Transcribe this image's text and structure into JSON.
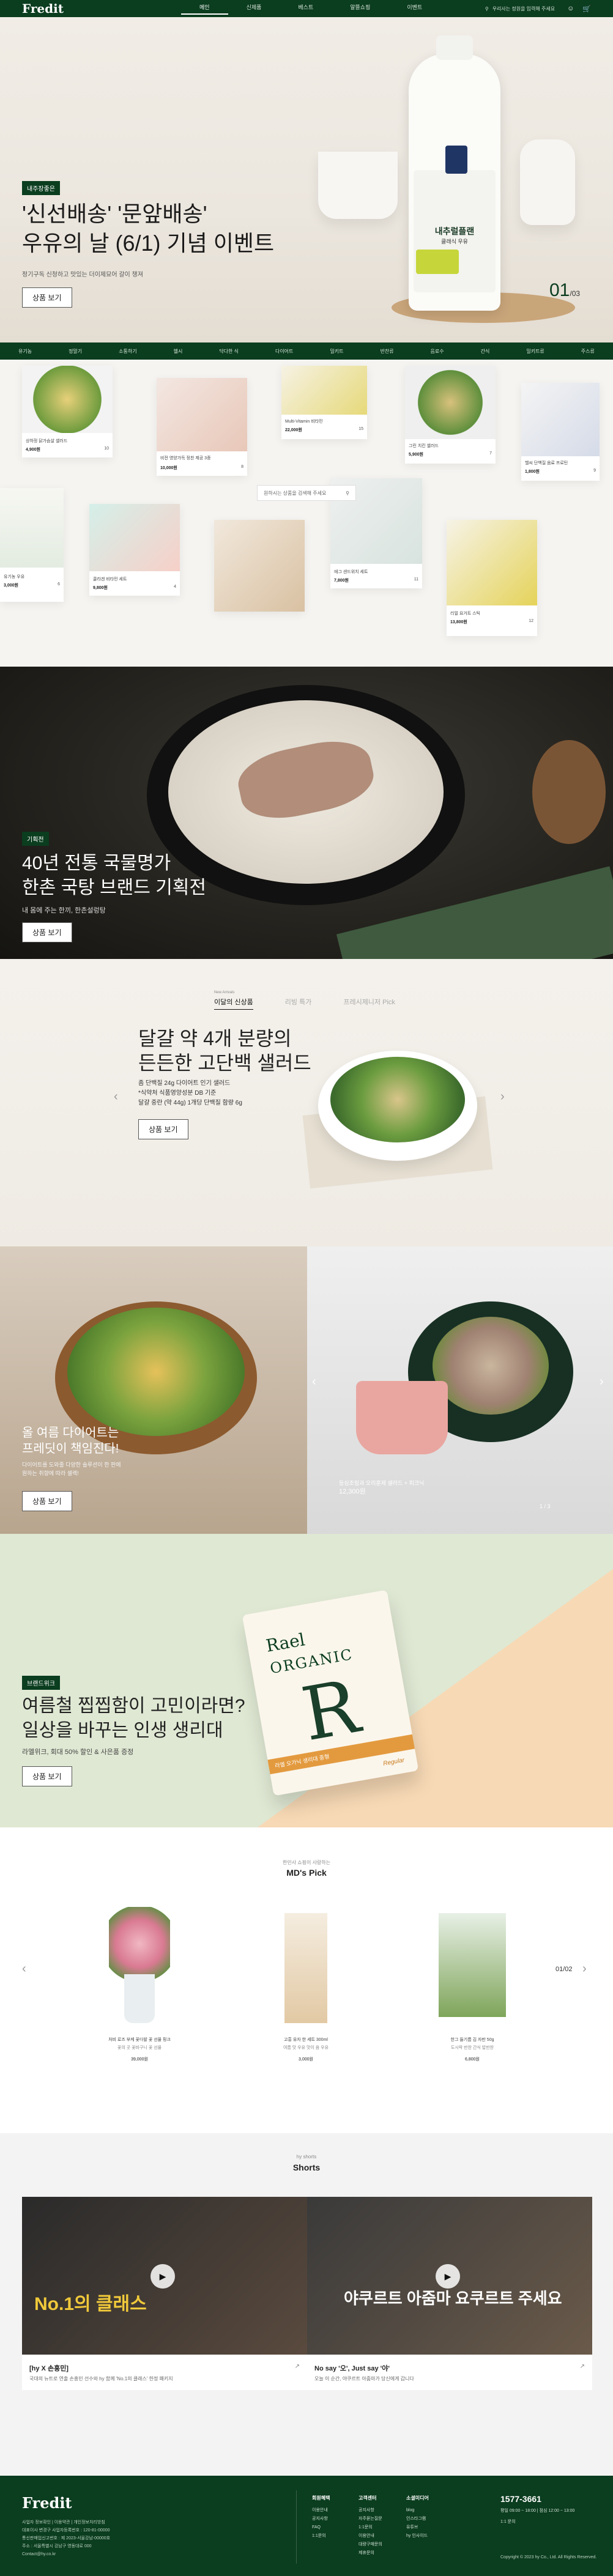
{
  "header": {
    "logo": "Fredit",
    "nav": [
      "메인",
      "신제품",
      "베스트",
      "알뜰쇼핑",
      "이벤트"
    ],
    "search_placeholder": "우리사는 정원을 입력해 주세요"
  },
  "hero": {
    "tag": "내주장좋은",
    "title_line1": "'신선배송' '문앞배송'",
    "title_line2": "우유의 날 (6/1) 기념 이벤트",
    "desc": "정기구독 신청하고 맛있는 더이제묘어 갈이 챙져",
    "button": "상품 보기",
    "bottle_brand": "내추럴플랜",
    "bottle_sub": "클래식 우유",
    "pager_current": "01",
    "pager_total": "/03"
  },
  "categories": [
    "유기농",
    "정말기",
    "소통하기",
    "헬시",
    "닥다한 식",
    "다이어트",
    "밀키트",
    "반찬류",
    "음료수",
    "간식",
    "밀키트류",
    "주스류"
  ],
  "collage": {
    "search_placeholder": "원하시는 상품을 검색해 주세요",
    "products": [
      {
        "name": "상하정 닭가슴살 샐러드",
        "price": "4,900원",
        "count": "10"
      },
      {
        "name": "비전 영양가득 정찬 제공 3종",
        "price": "10,000원",
        "count": "8"
      },
      {
        "name": "Multi-Vitamin 비타민",
        "price": "22,000원",
        "count": "15"
      },
      {
        "name": "그린 치킨 샐러드",
        "price": "5,900원",
        "count": "7"
      },
      {
        "name": "헬씨 단백질 음료 프로틴",
        "price": "1,800원",
        "count": "9"
      },
      {
        "name": "유기농 우유",
        "price": "3,000원",
        "count": "6"
      },
      {
        "name": "콜라겐 비타민 세트",
        "price": "9,800원",
        "count": "4"
      },
      {
        "name": "그래놀라 브런치",
        "price": "6,500원",
        "count": "5"
      },
      {
        "name": "에그 샌드위치 세트",
        "price": "7,800원",
        "count": "11"
      },
      {
        "name": "리얼 요거트 스틱",
        "price": "13,800원",
        "count": "12"
      }
    ]
  },
  "gukbap": {
    "tag": "기획전",
    "title_line1": "40년 전통 국물명가",
    "title_line2": "한촌 국탕 브랜드 기획전",
    "desc": "내 몸에 주는 한끼, 한촌설렁탕",
    "button": "상품 보기"
  },
  "salad": {
    "tabs_sub": "New Arrivals",
    "tabs": [
      "이달의 신상품",
      "리빙 특가",
      "프레시제니저 Pick"
    ],
    "title_line1": "달걀 약 4개 분량의",
    "title_line2": "든든한 고단백 샐러드",
    "desc_line1": "좀 단백질 24g 다이어트 인기 샐러드",
    "desc_line2": "*식약처 식품영양성분 DB 기준",
    "desc_line3": "달걀 중란 (약 44g) 1개당 단백질 함량 6g",
    "button": "상품 보기"
  },
  "diet": {
    "title_line1": "올 여름 다이어트는",
    "title_line2": "프레딧이 책임진다!",
    "desc_line1": "다이어트를 도와줄 다양한 솔루션이 한 판에",
    "desc_line2": "원하는 취향에 따라 셀렉!",
    "button": "상품 보기",
    "caption": "등심조림과 오리훈제 샐러드 + 피크닉",
    "caption_price": "12,300원",
    "pager": "1 / 3"
  },
  "pad": {
    "tag": "브랜드위크",
    "title_line1": "여름철 찝찝함이 고민이라면?",
    "title_line2": "일상을 바꾸는 인생 생리대",
    "desc": "라엘위크, 회대 50% 할인 & 사은품 증정",
    "button": "상품 보기",
    "pkg_brand": "Rael",
    "pkg_organic": "ORGANIC",
    "pkg_letter": "R",
    "pkg_band": "라엘 오가닉 생리대 중형",
    "pkg_regular": "Regular"
  },
  "mdpick": {
    "sub": "한민사 쇼핑이 사랑하는",
    "title": "MD's Pick",
    "pager": "01/02",
    "items": [
      {
        "name": "처비 로즈 부케 꽃다발 꽃 선물 핑크",
        "desc": "꽃의 곳 꽃바구니 꽃 선물",
        "price": "39,000원"
      },
      {
        "name": "고흥 유자 한 세트 300ml",
        "desc": "여름 맛 우유 맛이 음 우유",
        "price": "3,000원"
      },
      {
        "name": "한그 들기름 김 자반 50g",
        "desc": "도시락 반찬 간식 밥반찬",
        "price": "6,800원"
      }
    ]
  },
  "shorts": {
    "sub": "hy shorts",
    "title": "Shorts",
    "cards": [
      {
        "title": "[hy X 손흥민]",
        "desc": "국대의 뉴트로 연출 손흥민 선수와 hy 함께 'No.1의 클래스' 한정 패키지"
      },
      {
        "title": "No say '오', Just say '야'",
        "desc": "오늘 이 순간, 야쿠르트 아줌마가 당신에게 갑니다"
      }
    ],
    "overlay1": "No.1의 클래스",
    "overlay2": "야쿠르트 아줌마 요쿠르트 주세요"
  },
  "footer": {
    "logo": "Fredit",
    "info_lines": [
      "사업자 정보확인  |  이용약관  |  개인정보처리방침",
      "대표이사 변경구  사업자등록번호 : 120-81-00000",
      "통신판매업신고번호 : 제 2023-서울강남-00000호",
      "주소 : 서울특별시 강남구 영동대로 000",
      "Contact@hy.co.kr"
    ],
    "cols": [
      {
        "title": "회원혜택",
        "items": [
          "이용안내",
          "공지사항",
          "FAQ",
          "1:1문의"
        ]
      },
      {
        "title": "고객센터",
        "items": [
          "공지사항",
          "자주묻는질문",
          "1:1문의",
          "이용안내",
          "대량구매문의",
          "제휴문의"
        ]
      },
      {
        "title": "소셜미디어",
        "items": [
          "blog",
          "인스타그램",
          "유튜브",
          "hy 인사이드"
        ]
      }
    ],
    "cs_title": "1577-3661",
    "cs_hours": "평일 09:00 ~ 18:00  |  점심 12:00 ~ 13:00",
    "cs_extra": "1:1 문의",
    "copyright": "Copyright © 2023 hy Co., Ltd. All Rights Reserved."
  }
}
